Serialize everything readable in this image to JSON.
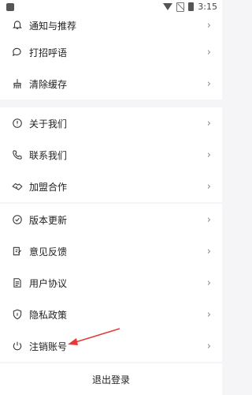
{
  "status_bar": {
    "time": "3:15"
  },
  "groups": [
    {
      "items": [
        {
          "label": "通知与推荐",
          "icon": "bell-icon"
        },
        {
          "label": "打招呼语",
          "icon": "chat-bubble-icon"
        },
        {
          "label": "清除缓存",
          "icon": "broom-icon"
        }
      ]
    },
    {
      "items": [
        {
          "label": "关于我们",
          "icon": "info-circle-icon"
        },
        {
          "label": "联系我们",
          "icon": "phone-icon"
        },
        {
          "label": "加盟合作",
          "icon": "handshake-icon"
        }
      ]
    },
    {
      "items": [
        {
          "label": "版本更新",
          "icon": "check-circle-icon"
        },
        {
          "label": "意见反馈",
          "icon": "edit-note-icon"
        },
        {
          "label": "用户协议",
          "icon": "document-icon"
        },
        {
          "label": "隐私政策",
          "icon": "shield-icon"
        },
        {
          "label": "注销账号",
          "icon": "power-icon"
        }
      ]
    }
  ],
  "logout_label": "退出登录",
  "annotation": {
    "type": "red-arrow",
    "points_to": "注销账号",
    "color": "#e53935"
  },
  "chevron": "›"
}
